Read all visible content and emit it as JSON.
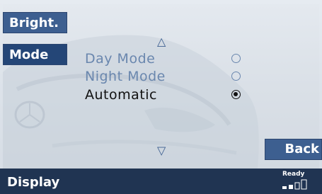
{
  "left_buttons": {
    "brightness_label": "Bright.",
    "mode_label": "Mode"
  },
  "options": [
    {
      "label": "Day Mode",
      "selected": false
    },
    {
      "label": "Night Mode",
      "selected": false
    },
    {
      "label": "Automatic",
      "selected": true
    }
  ],
  "scroll": {
    "up_glyph": "△",
    "down_glyph": "▽"
  },
  "back_label": "Back",
  "status_bar": {
    "title": "Display",
    "status_text": "Ready",
    "signal_level_bars_filled": 2,
    "signal_level_bars_total": 4
  },
  "icons": {
    "background": "car-front-illustration",
    "selected_radio": "radio-filled-icon",
    "unselected_radio": "radio-empty-icon",
    "signal": "signal-strength-icon"
  },
  "colors": {
    "button_blue": "#3d5f90",
    "mode_button_active": "#244677",
    "option_inactive_text": "#6a87ae",
    "option_active_text": "#111111",
    "status_bar_bg": "#203452",
    "screen_bg": "#dde3ea"
  }
}
